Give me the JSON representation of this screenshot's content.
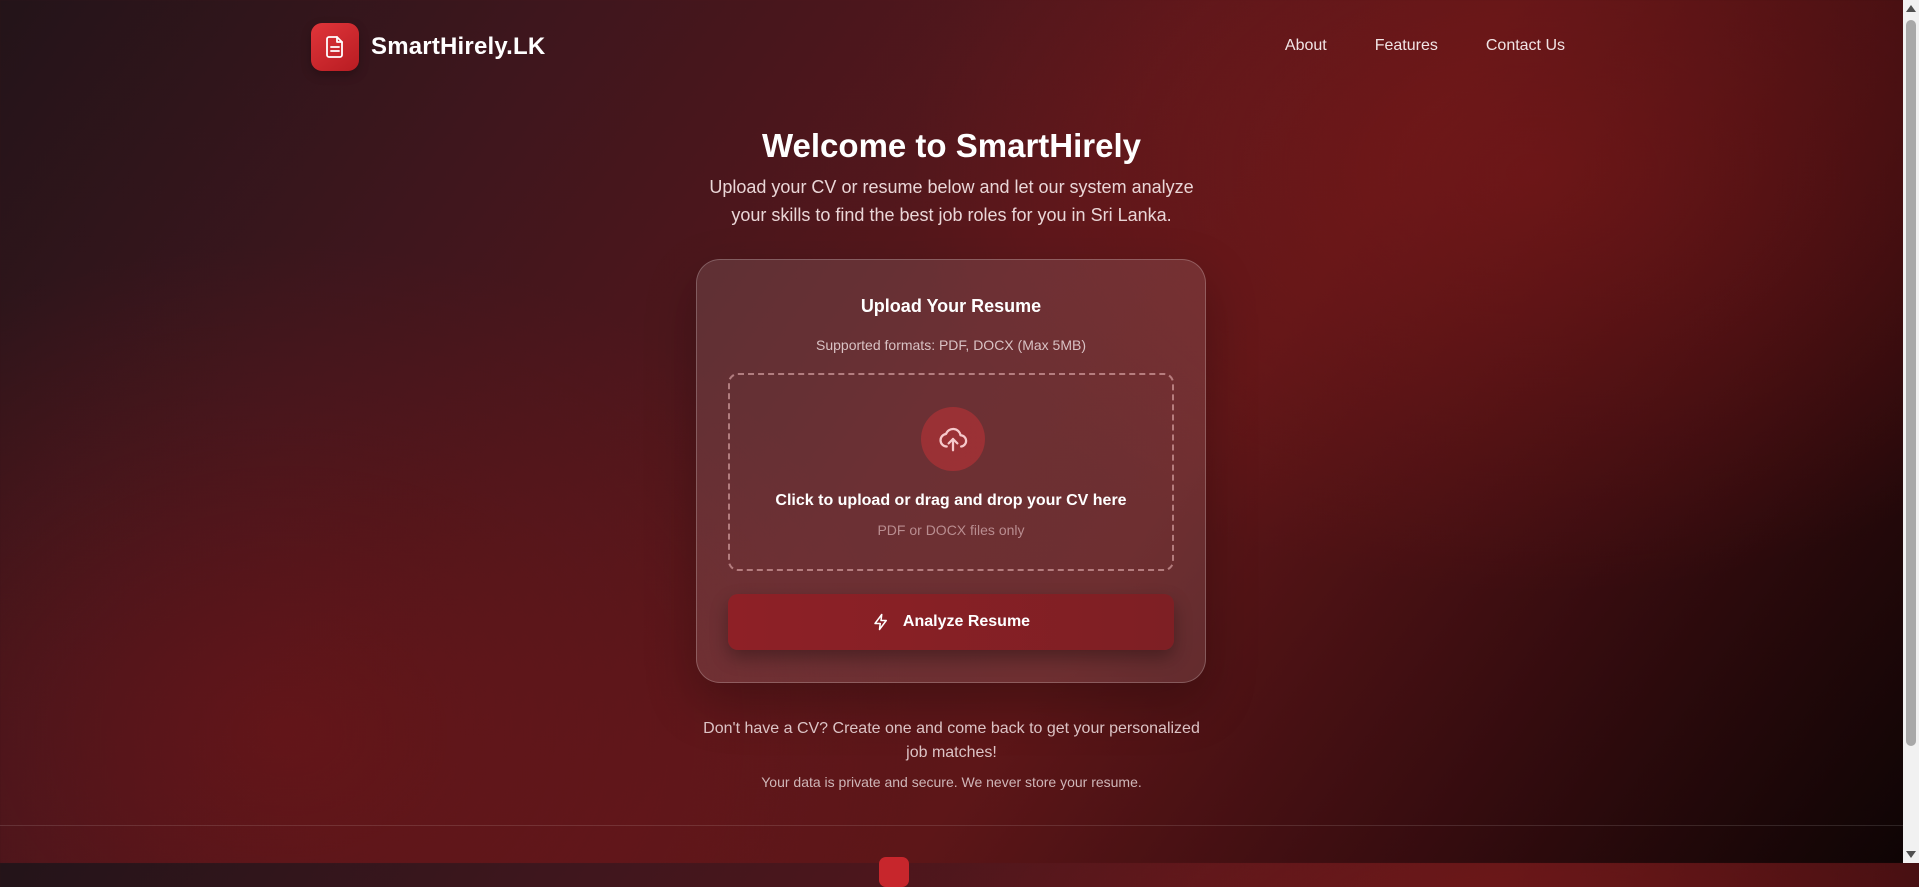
{
  "header": {
    "brand_name": "SmartHirely.LK",
    "logo_icon": "document-icon",
    "nav": [
      {
        "label": "About"
      },
      {
        "label": "Features"
      },
      {
        "label": "Contact Us"
      }
    ]
  },
  "hero": {
    "title": "Welcome to SmartHirely",
    "subtitle": "Upload your CV or resume below and let our system analyze your skills to find the best job roles for you in Sri Lanka."
  },
  "upload_card": {
    "title": "Upload Your Resume",
    "formats": "Supported formats: PDF, DOCX (Max 5MB)",
    "dropzone": {
      "icon": "cloud-upload-icon",
      "title": "Click to upload or drag and drop your CV here",
      "subtitle": "PDF or DOCX files only"
    },
    "analyze_button": {
      "icon": "lightning-icon",
      "label": "Analyze Resume"
    }
  },
  "footer_note": "Don't have a CV? Create one and come back to get your personalized job matches!",
  "privacy_note": "Your data is private and secure. We never store your resume.",
  "colors": {
    "accent": "#c7262c",
    "button": "#8e2026"
  }
}
